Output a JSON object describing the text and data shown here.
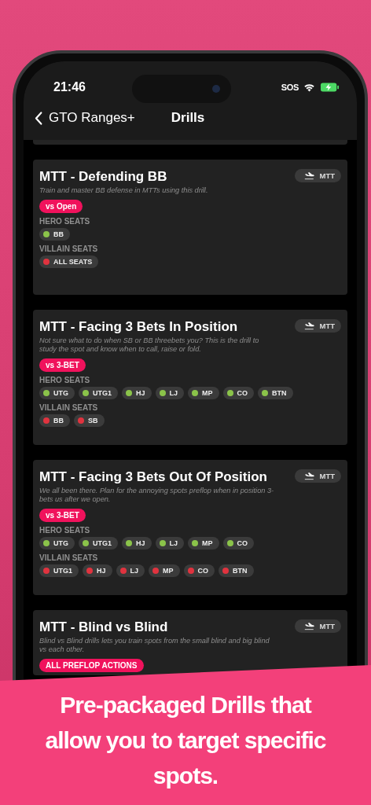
{
  "status_bar": {
    "time": "21:46",
    "carrier": "SOS"
  },
  "nav": {
    "back_label": "GTO Ranges+",
    "title": "Drills"
  },
  "drills": [
    {
      "title": "MTT - Defending BB",
      "tag": "MTT",
      "description": "Train and master BB defense in MTTs using this drill.",
      "action": "vs Open",
      "seat_groups": [
        {
          "label": "HERO SEATS",
          "color": "#8bc34a",
          "seats": [
            "BB"
          ]
        },
        {
          "label": "VILLAIN SEATS",
          "color": "#e0333f",
          "seats": [
            "ALL SEATS"
          ]
        }
      ]
    },
    {
      "title": "MTT - Facing 3 Bets In Position",
      "tag": "MTT",
      "description": "Not sure what to do when SB or BB threebets you? This is the drill to study the spot and know when to call, raise or fold.",
      "action": "vs 3-BET",
      "seat_groups": [
        {
          "label": "HERO SEATS",
          "color": "#8bc34a",
          "seats": [
            "UTG",
            "UTG1",
            "HJ",
            "LJ",
            "MP",
            "CO",
            "BTN"
          ]
        },
        {
          "label": "VILLAIN SEATS",
          "color": "#e0333f",
          "seats": [
            "BB",
            "SB"
          ]
        }
      ]
    },
    {
      "title": "MTT - Facing 3 Bets Out Of Position",
      "tag": "MTT",
      "description": "We all been there. Plan for the annoying spots preflop when in position 3-bets us after we open.",
      "action": "vs 3-BET",
      "seat_groups": [
        {
          "label": "HERO SEATS",
          "color": "#8bc34a",
          "seats": [
            "UTG",
            "UTG1",
            "HJ",
            "LJ",
            "MP",
            "CO"
          ]
        },
        {
          "label": "VILLAIN SEATS",
          "color": "#e0333f",
          "seats": [
            "UTG1",
            "HJ",
            "LJ",
            "MP",
            "CO",
            "BTN"
          ]
        }
      ]
    },
    {
      "title": "MTT - Blind vs Blind",
      "tag": "MTT",
      "description": "Blind vs Blind drills lets you train spots from the small blind and big blind vs each other.",
      "action": "ALL PREFLOP ACTIONS"
    }
  ],
  "caption": "Pre-packaged Drills that allow you to target specific spots."
}
